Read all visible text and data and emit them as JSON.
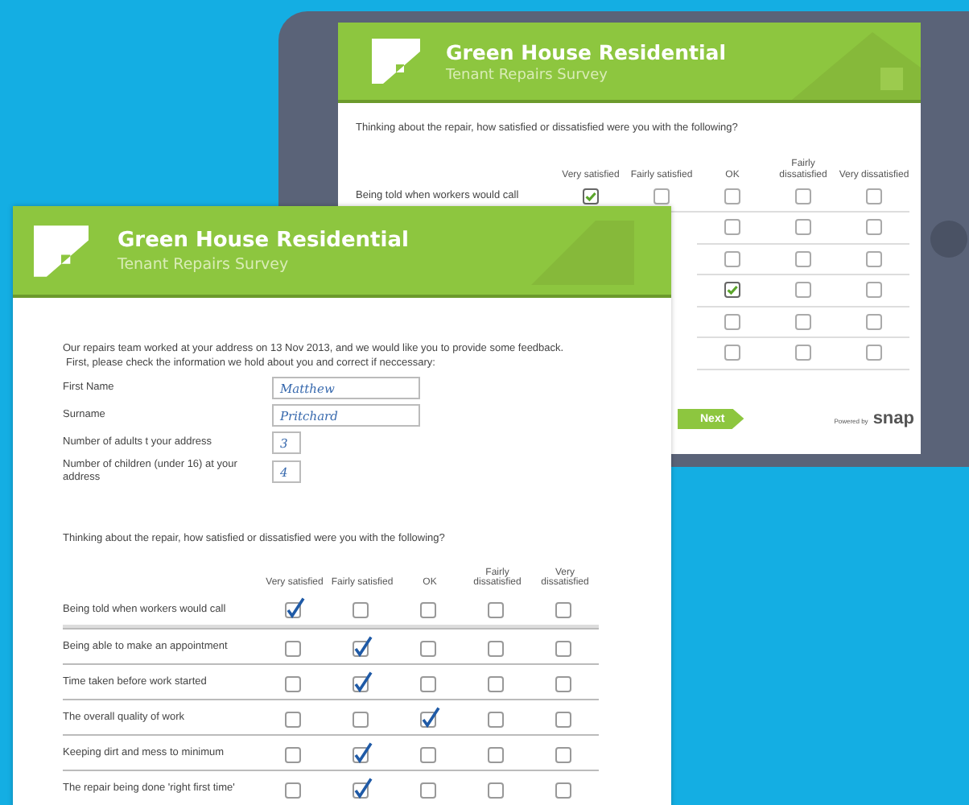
{
  "tablet": {
    "header": {
      "title": "Green House Residential",
      "subtitle": "Tenant Repairs Survey"
    },
    "question": "Thinking about the repair, how satisfied or dissatisfied were you with the following?",
    "columns": [
      "Very satisfied",
      "Fairly satisfied",
      "OK",
      "Fairly dissatisfied",
      "Very dissatisfied"
    ],
    "rows": [
      {
        "label": "Being told when workers would call",
        "checks": [
          true,
          false,
          false,
          false,
          false
        ]
      },
      {
        "checks": [
          false,
          false,
          false
        ]
      },
      {
        "checks": [
          false,
          false,
          false
        ]
      },
      {
        "checks": [
          true,
          false,
          false
        ]
      },
      {
        "checks": [
          false,
          false,
          false
        ]
      },
      {
        "checks": [
          false,
          false,
          false
        ]
      }
    ],
    "next_button": "Next",
    "powered_by": "Powered by",
    "brand": "snap"
  },
  "paper": {
    "header": {
      "title": "Green House Residential",
      "subtitle": "Tenant Repairs Survey"
    },
    "intro": [
      "Our repairs team worked at your address on 13 Nov 2013, and we would like you to provide some feedback.",
      "First, please check the information we hold about you and correct if neccessary:"
    ],
    "fields": [
      {
        "label": "First Name",
        "value": "Matthew",
        "kind": "wide"
      },
      {
        "label": "Surname",
        "value": "Pritchard",
        "kind": "wide"
      },
      {
        "label": "Number of adults t your address",
        "value": "3",
        "kind": "short"
      },
      {
        "label": "Number of children (under 16) at your address",
        "value": "4",
        "kind": "short"
      }
    ],
    "question": "Thinking about the repair, how satisfied or dissatisfied were you with the following?",
    "columns": [
      "Very satisfied",
      "Fairly satisfied",
      "OK",
      "Fairly dissatisfied",
      "Very dissatisfied"
    ],
    "rows": [
      {
        "label": "Being told when workers would call",
        "checks": [
          true,
          false,
          false,
          false,
          false
        ]
      },
      {
        "label": "Being able to make an appointment",
        "checks": [
          false,
          true,
          false,
          false,
          false
        ]
      },
      {
        "label": "Time taken before work started",
        "checks": [
          false,
          true,
          false,
          false,
          false
        ]
      },
      {
        "label": "The overall quality of work",
        "checks": [
          false,
          false,
          true,
          false,
          false
        ]
      },
      {
        "label": "Keeping dirt and mess to minimum",
        "checks": [
          false,
          true,
          false,
          false,
          false
        ]
      },
      {
        "label": "The repair being done 'right first time'",
        "checks": [
          false,
          true,
          false,
          false,
          false
        ]
      }
    ]
  }
}
